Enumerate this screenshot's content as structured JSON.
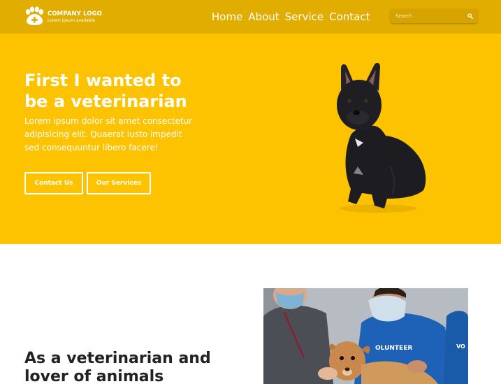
{
  "header": {
    "logo_title": "COMPANY LOGO",
    "logo_subtitle": "Lorem Ipsum available",
    "nav": [
      "Home",
      "About",
      "Service",
      "Contact"
    ],
    "search_placeholder": "Search"
  },
  "hero": {
    "title_line1": "First I wanted to",
    "title_line2": "be a veterinarian",
    "text": "Lorem ipsum dolor sit amet consectetur adipisicing elit. Quaerat iusto impedit sed consequuntur libero facere!",
    "buttons": {
      "contact": "Contact Us",
      "services": "Our Services"
    }
  },
  "about": {
    "title": "As a veterinarian and lover of animals",
    "photo_shirt_text_1": "OLUNTEER",
    "photo_shirt_text_2": "VO"
  },
  "colors": {
    "header": "#e0ad00",
    "hero": "#fdc300",
    "text_dark": "#222222"
  }
}
